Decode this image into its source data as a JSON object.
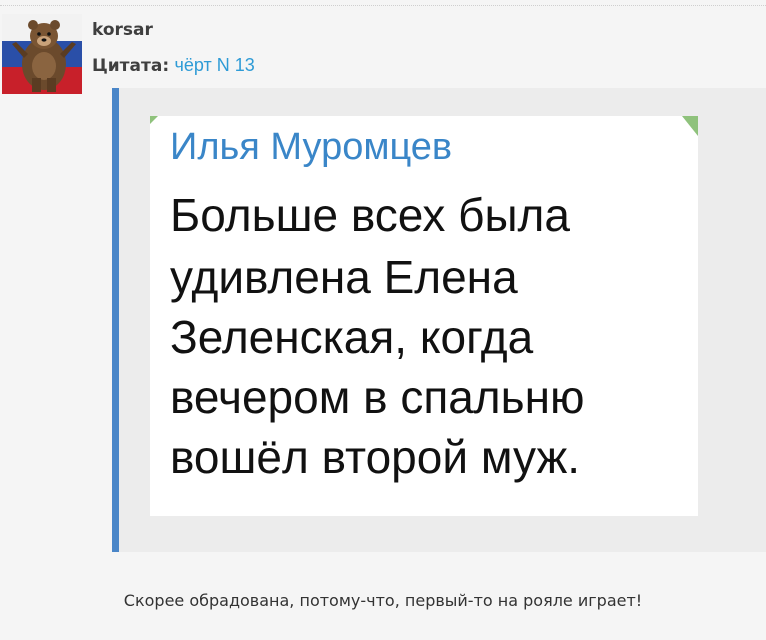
{
  "post": {
    "username": "korsar",
    "avatar_icon": "bear-russian-flag-avatar",
    "quote_label": "Цитата:",
    "quote_author": "чёрт N 13",
    "quote_image": {
      "author": "Илья Муромцев",
      "lines": [
        "Больше всех была",
        "удивлена Елена",
        "Зеленская, когда",
        "вечером в спальню",
        "вошёл второй муж."
      ]
    },
    "reply_text": "Скорее обрадована, потому-что, первый-то на рояле играет!"
  },
  "colors": {
    "quote_border": "#4a86c8",
    "quote_author_link": "#2e9bd6",
    "image_author": "#3a86c8",
    "corner_accent": "#8fc27c"
  }
}
